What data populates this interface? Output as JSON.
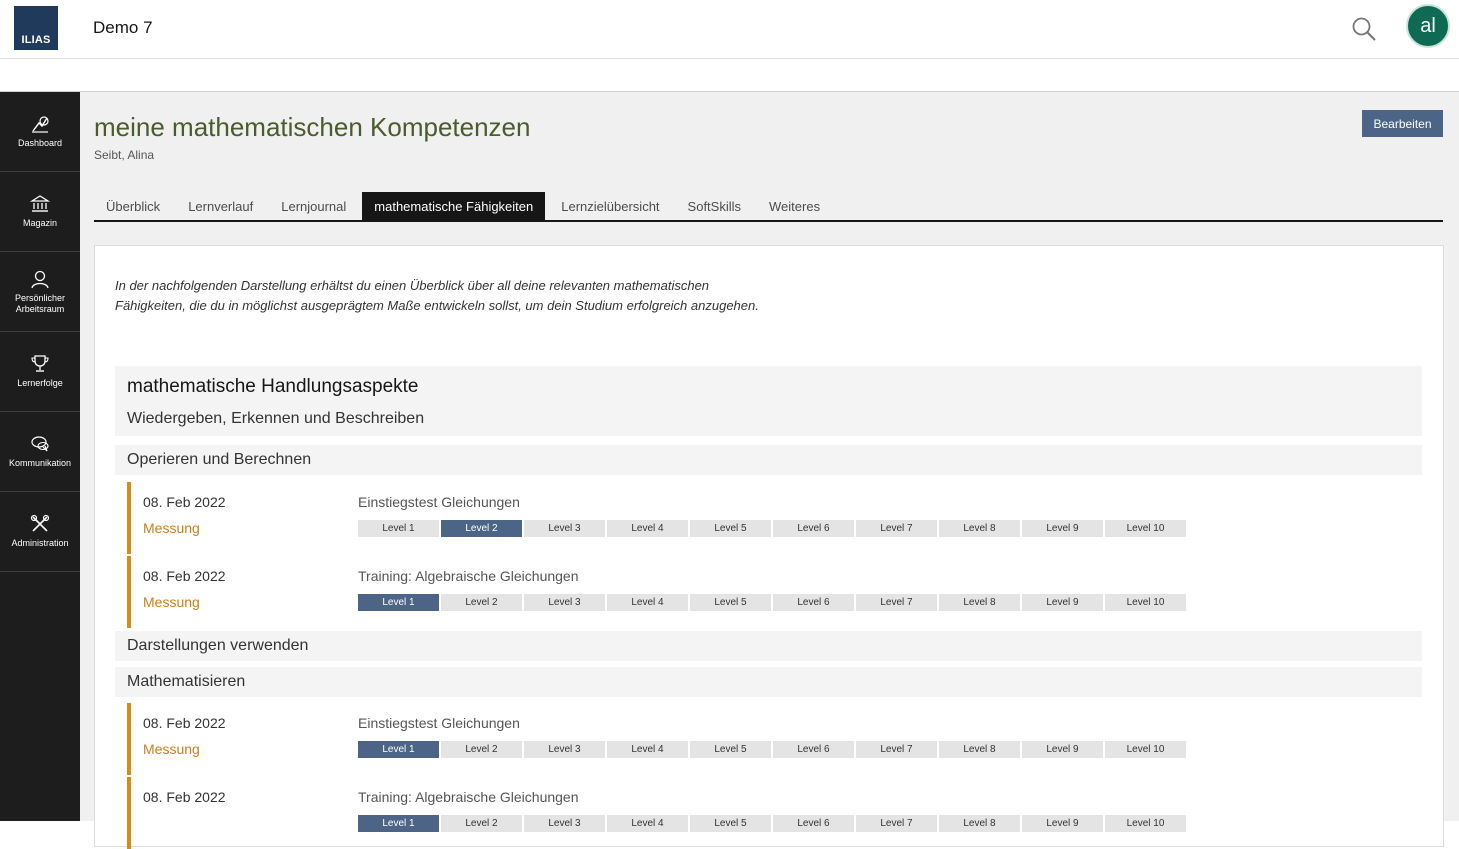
{
  "header": {
    "logo_text": "ILIAS",
    "site_title": "Demo 7",
    "avatar_initials": "al"
  },
  "sidebar": {
    "items": [
      {
        "label": "Dashboard",
        "icon": "dashboard-icon"
      },
      {
        "label": "Magazin",
        "icon": "bank-icon"
      },
      {
        "label": "Persönlicher Arbeitsraum",
        "icon": "user-icon"
      },
      {
        "label": "Lernerfolge",
        "icon": "trophy-icon"
      },
      {
        "label": "Kommunikation",
        "icon": "chat-icon"
      },
      {
        "label": "Administration",
        "icon": "tools-icon"
      }
    ]
  },
  "page": {
    "title": "meine mathematischen Kompetenzen",
    "subtitle": "Seibt, Alina",
    "edit_label": "Bearbeiten"
  },
  "tabs": [
    {
      "label": "Überblick",
      "active": false
    },
    {
      "label": "Lernverlauf",
      "active": false
    },
    {
      "label": "Lernjournal",
      "active": false
    },
    {
      "label": "mathematische Fähigkeiten",
      "active": true
    },
    {
      "label": "Lernzielübersicht",
      "active": false
    },
    {
      "label": "SoftSkills",
      "active": false
    },
    {
      "label": "Weiteres",
      "active": false
    }
  ],
  "content": {
    "intro": "In der nachfolgenden Darstellung erhältst du einen Überblick über all deine relevanten mathematischen Fähigkeiten, die du in möglichst ausgeprägtem Maße entwickeln sollst, um dein Studium erfolgreich anzugehen.",
    "group_title": "mathematische Handlungsaspekte",
    "group_subtitle": "Wiedergeben, Erkennen und Beschreiben",
    "sections": [
      {
        "title": "Operieren und Berechnen"
      },
      {
        "title": "Darstellungen verwenden"
      },
      {
        "title": "Mathematisieren"
      }
    ],
    "entries": [
      {
        "date": "08. Feb 2022",
        "kind": "Messung",
        "title": "Einstiegstest Gleichungen",
        "active_level": 2
      },
      {
        "date": "08. Feb 2022",
        "kind": "Messung",
        "title": "Training: Algebraische Gleichungen",
        "active_level": 1
      },
      {
        "date": "08. Feb 2022",
        "kind": "Messung",
        "title": "Einstiegstest Gleichungen",
        "active_level": 1
      },
      {
        "date": "08. Feb 2022",
        "kind": "",
        "title": "Training: Algebraische Gleichungen",
        "active_level": 1
      }
    ],
    "levels": [
      "Level 1",
      "Level 2",
      "Level 3",
      "Level 4",
      "Level 5",
      "Level 6",
      "Level 7",
      "Level 8",
      "Level 9",
      "Level 10"
    ]
  },
  "colors": {
    "accent_blue": "#4c6586",
    "accent_orange": "#d38b1c",
    "title_green": "#4b5b2e",
    "sidebar_bg": "#1d1d1d"
  }
}
